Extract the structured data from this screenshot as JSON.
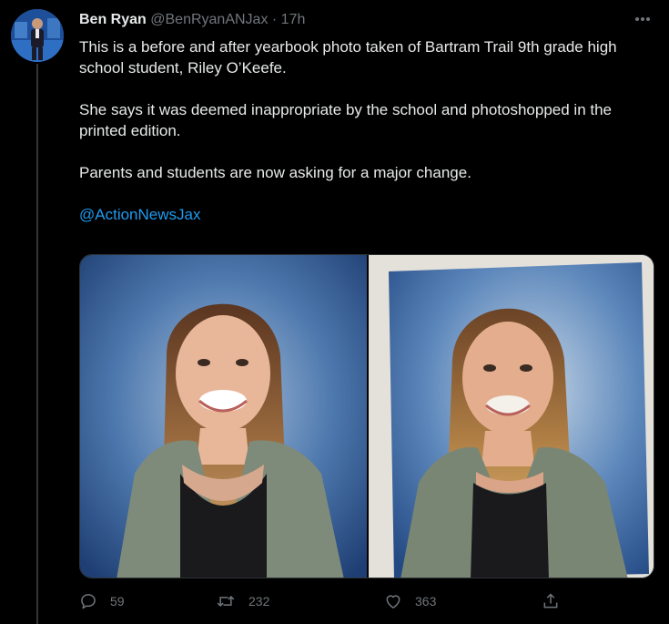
{
  "tweet": {
    "author": {
      "display_name": "Ben Ryan",
      "handle": "@BenRyanANJax",
      "separator": "·",
      "time": "17h"
    },
    "menu_icon": "more-horizontal-icon",
    "text": {
      "p1": "This is a before and after yearbook photo taken of Bartram Trail 9th grade high school student, Riley O’Keefe.",
      "p2": "She says it was deemed inappropriate by the school and photoshopped in the printed edition.",
      "p3": "Parents and students are now asking for a major change.",
      "mention": "@ActionNewsJax"
    },
    "media": [
      {
        "name": "original-yearbook-photo"
      },
      {
        "name": "edited-yearbook-photo"
      }
    ],
    "actions": {
      "replies": "59",
      "retweets": "232",
      "likes": "363",
      "reply_icon": "reply-icon",
      "retweet_icon": "retweet-icon",
      "like_icon": "heart-icon",
      "share_icon": "share-icon"
    },
    "colors": {
      "background": "#000000",
      "text": "#e7e9ea",
      "muted": "#71767b",
      "link": "#1d9bf0"
    }
  }
}
